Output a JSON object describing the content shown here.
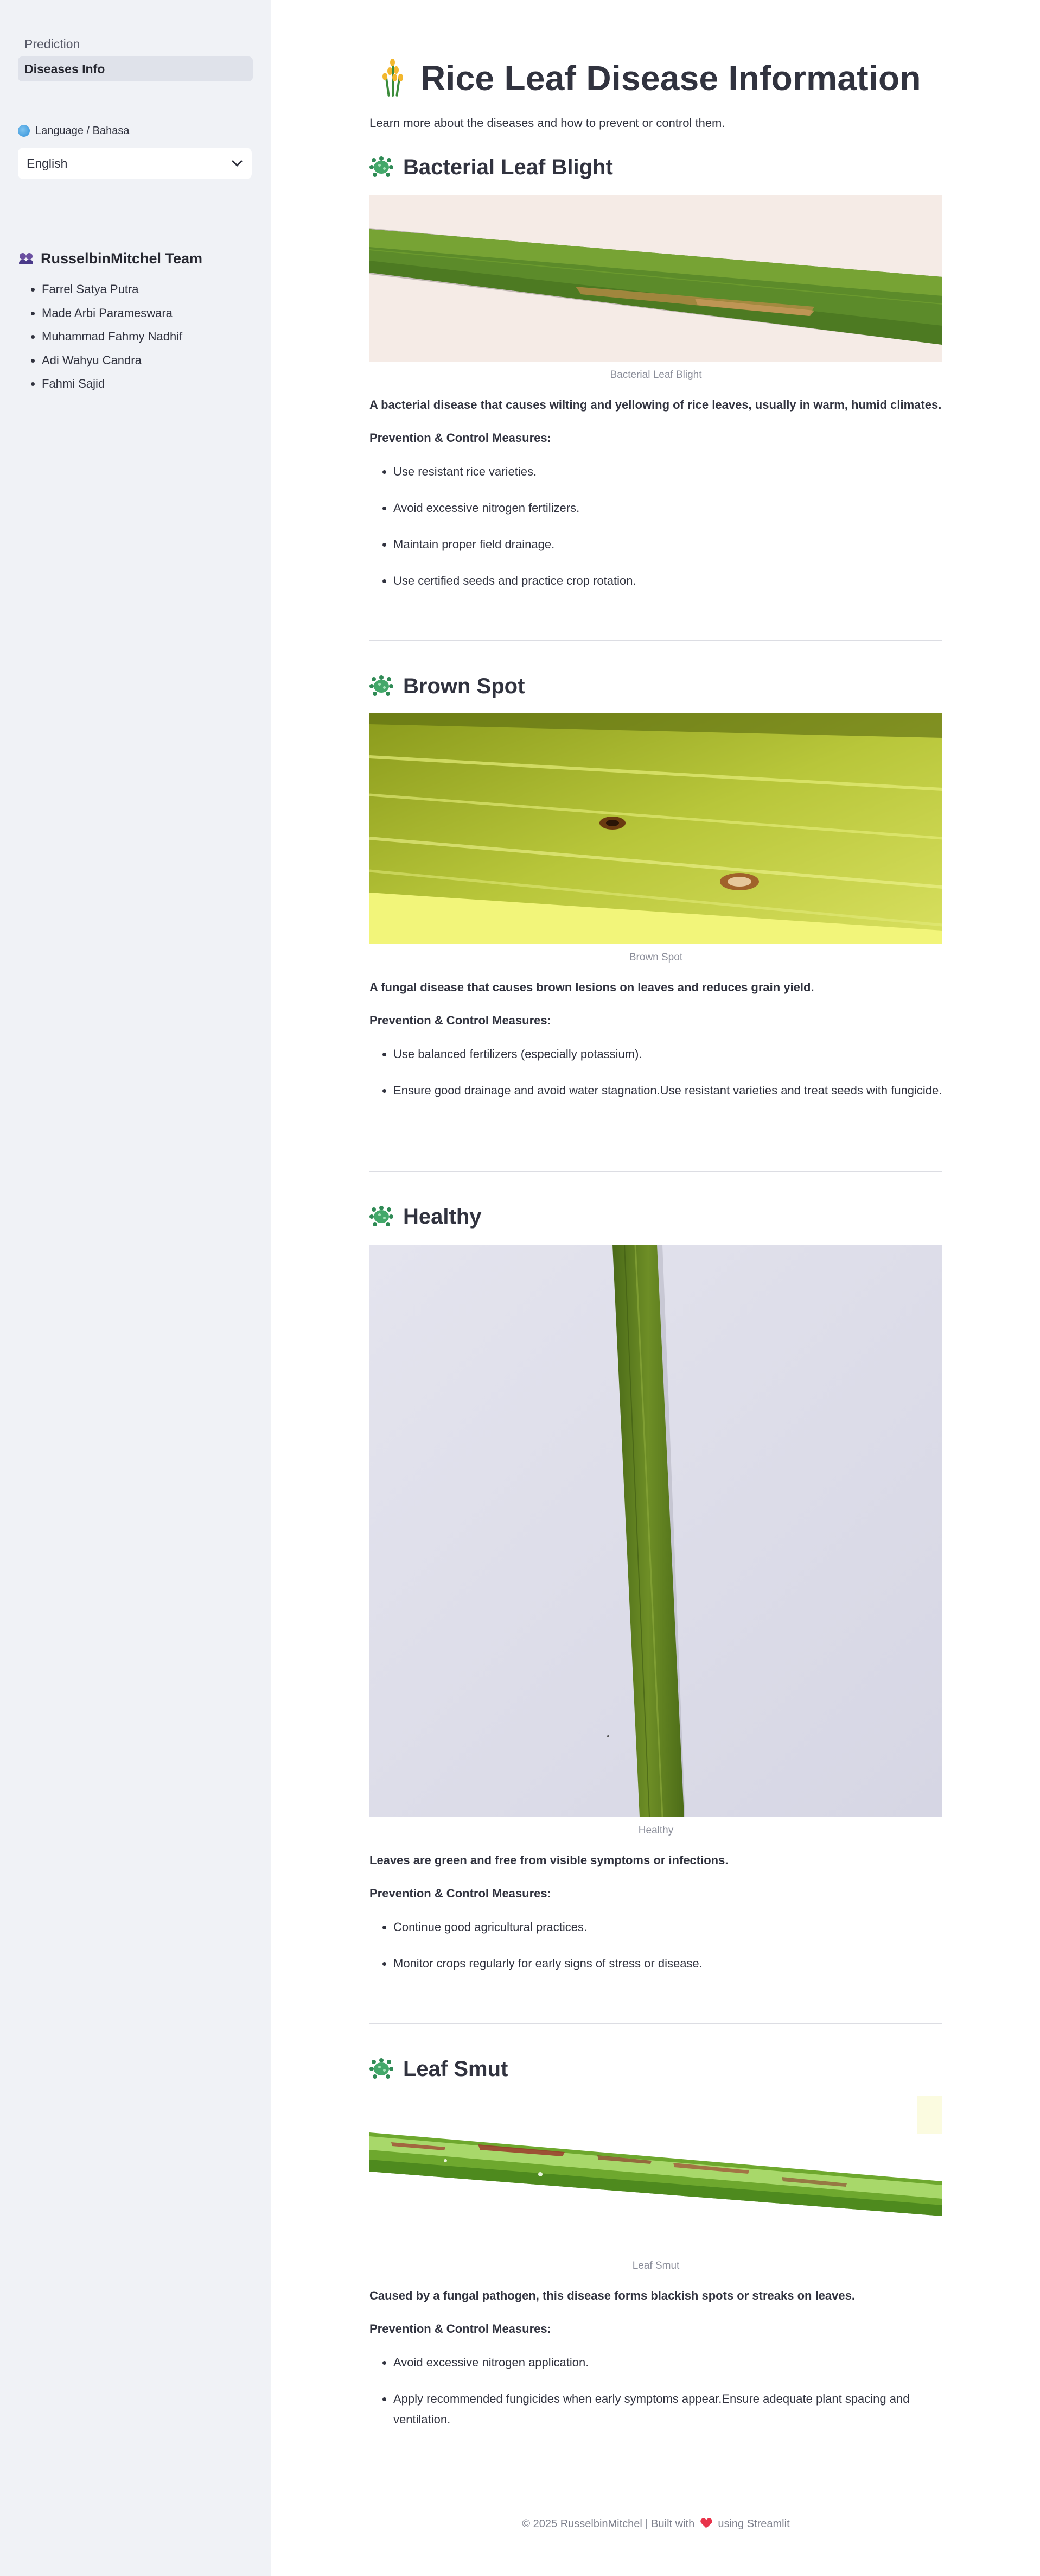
{
  "sidebar": {
    "nav": [
      {
        "label": "Prediction",
        "active": false
      },
      {
        "label": "Diseases Info",
        "active": true
      }
    ],
    "language_label": "Language / Bahasa",
    "language_selected": "English",
    "team_title": "RusselbinMitchel Team",
    "team_members": [
      "Farrel Satya Putra",
      "Made Arbi Parameswara",
      "Muhammad Fahmy Nadhif",
      "Adi Wahyu Candra",
      "Fahmi Sajid"
    ]
  },
  "main": {
    "title": "Rice Leaf Disease Information",
    "subtitle": "Learn more about the diseases and how to prevent or control them.",
    "prevention_label": "Prevention & Control Measures:",
    "diseases": [
      {
        "name": "Bacterial Leaf Blight",
        "caption": "Bacterial Leaf Blight",
        "description": "A bacterial disease that causes wilting and yellowing of rice leaves, usually in warm, humid climates.",
        "measures": [
          "Use resistant rice varieties.",
          "Avoid excessive nitrogen fertilizers.",
          "Maintain proper field drainage.",
          "Use certified seeds and practice crop rotation."
        ]
      },
      {
        "name": "Brown Spot",
        "caption": "Brown Spot",
        "description": "A fungal disease that causes brown lesions on leaves and reduces grain yield.",
        "measures": [
          "Use balanced fertilizers (especially potassium).",
          "Ensure good drainage and avoid water stagnation.Use resistant varieties and treat seeds with fungicide."
        ]
      },
      {
        "name": "Healthy",
        "caption": "Healthy",
        "description": "Leaves are green and free from visible symptoms or infections.",
        "measures": [
          "Continue good agricultural practices.",
          "Monitor crops regularly for early signs of stress or disease."
        ]
      },
      {
        "name": "Leaf Smut",
        "caption": "Leaf Smut",
        "description": "Caused by a fungal pathogen, this disease forms blackish spots or streaks on leaves.",
        "measures": [
          "Avoid excessive nitrogen application.",
          "Apply recommended fungicides when early symptoms appear.Ensure adequate plant spacing and ventilation."
        ]
      }
    ],
    "footer": {
      "left": "© 2025 RusselbinMitchel | Built with",
      "right": "using Streamlit"
    }
  },
  "colors": {
    "sidebar_bg": "#f0f2f6",
    "active_nav_bg": "#dfe2ea",
    "text": "#31333f",
    "caption": "#8a8d99",
    "heart": "#e8334a"
  },
  "icons": {
    "title": "rice-icon",
    "section": "microbe-icon",
    "language": "globe-icon",
    "team": "people-icon",
    "dropdown": "chevron-down-icon",
    "footer": "heart-icon"
  }
}
